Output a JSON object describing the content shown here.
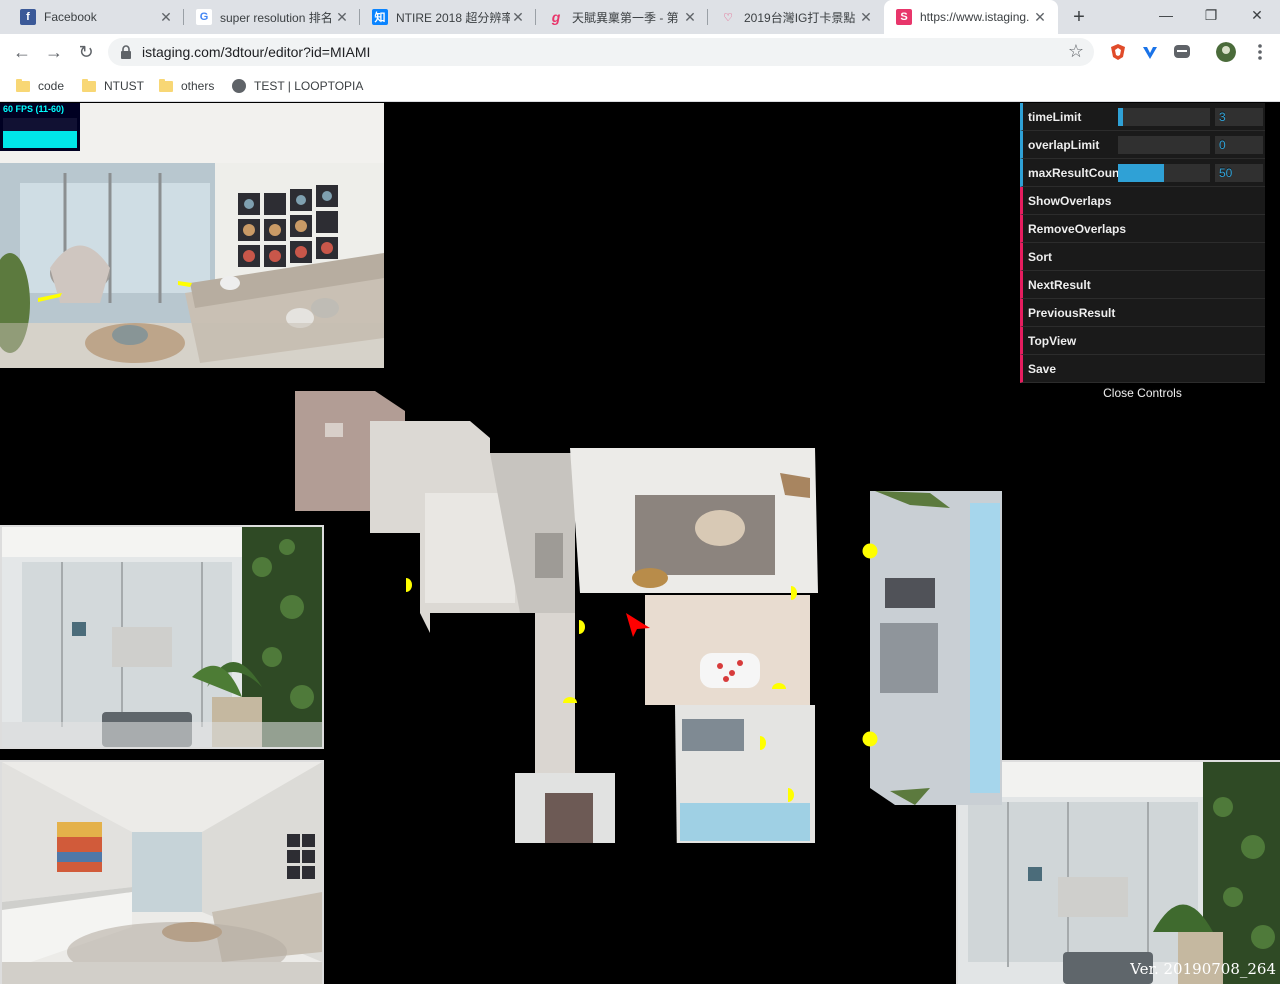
{
  "tabs": [
    {
      "title": "Facebook",
      "favicon_text": "f",
      "favicon_color": "#3b5998"
    },
    {
      "title": "super resolution 排名",
      "favicon_text": "G",
      "favicon_color": "#ffffff"
    },
    {
      "title": "NTIRE 2018 超分辨率",
      "favicon_text": "知",
      "favicon_color": "#0a84ff"
    },
    {
      "title": "天賦異稟第一季 - 第",
      "favicon_text": "g",
      "favicon_color": "#ffffff"
    },
    {
      "title": "2019台灣IG打卡景點",
      "favicon_text": "♡",
      "favicon_color": "#ffffff"
    },
    {
      "title": "https://www.istaging.",
      "favicon_text": "S",
      "favicon_color": "#e8366b"
    }
  ],
  "tab_close": "✕",
  "new_tab": "+",
  "window": {
    "minimize": "—",
    "restore": "❐",
    "close": "✕"
  },
  "nav": {
    "back": "←",
    "forward": "→",
    "reload": "↻"
  },
  "address": {
    "url": "istaging.com/3dtour/editor?id=MIAMI",
    "star": "☆"
  },
  "bookmarks": [
    {
      "label": "code",
      "icon": "folder-icon"
    },
    {
      "label": "NTUST",
      "icon": "folder-icon"
    },
    {
      "label": "others",
      "icon": "folder-icon"
    },
    {
      "label": "TEST | LOOPTOPIA",
      "icon": "globe-icon"
    }
  ],
  "stats": {
    "fps_label": "60 FPS (11-60)"
  },
  "controls": {
    "numbers": [
      {
        "label": "timeLimit",
        "value": "3",
        "fill_fraction": 0.05
      },
      {
        "label": "overlapLimit",
        "value": "0",
        "fill_fraction": 0.0
      },
      {
        "label": "maxResultCount",
        "value": "50",
        "fill_fraction": 0.5
      }
    ],
    "functions": [
      "ShowOverlaps",
      "RemoveOverlaps",
      "Sort",
      "NextResult",
      "PreviousResult",
      "TopView",
      "Save"
    ],
    "close_label": "Close Controls"
  },
  "colors": {
    "accent_number": "#2fa1d6",
    "accent_function": "#e61d5f",
    "marker": "#ffff00",
    "camera_arrow": "#ff0000"
  },
  "version": "Ver. 20190708_264"
}
